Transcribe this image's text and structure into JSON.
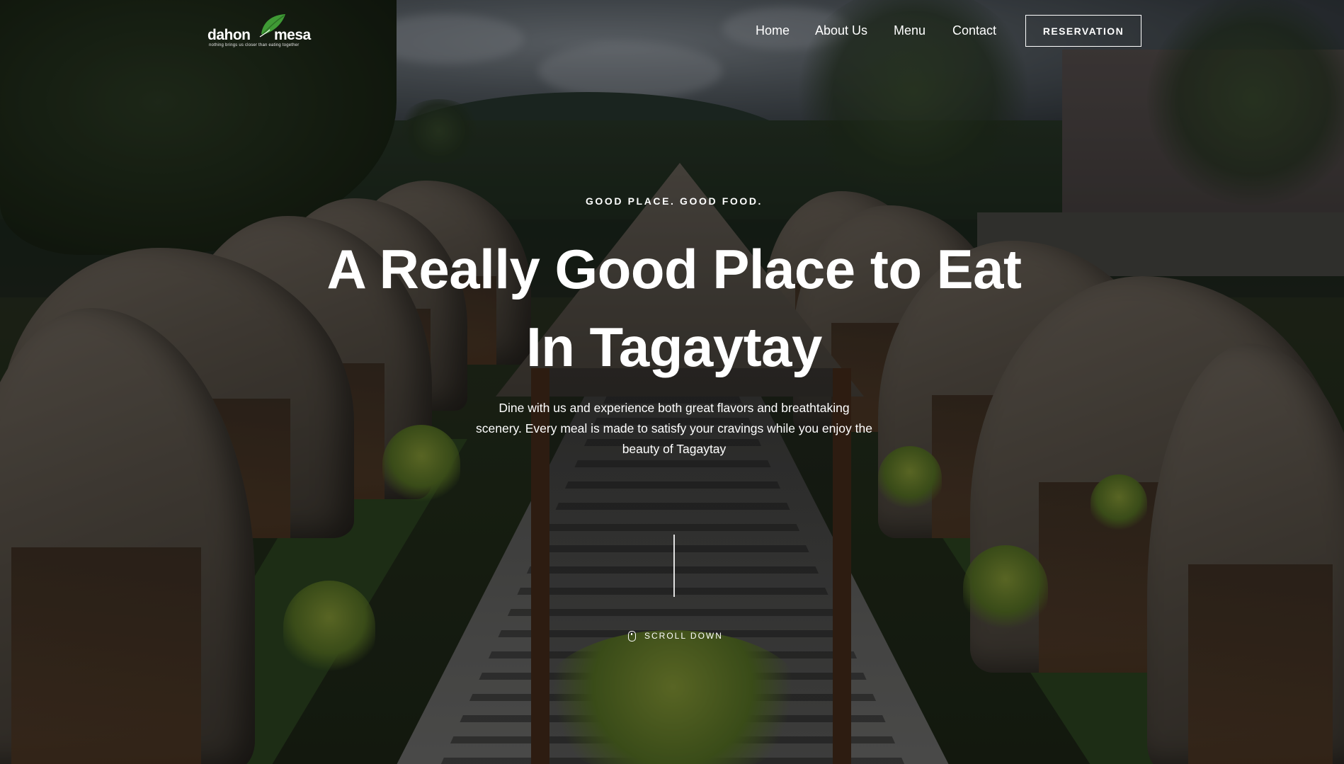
{
  "brand": {
    "name_left": "dahon",
    "name_right": "mesa",
    "tagline": "nothing brings us closer than eating together",
    "leaf_color": "#3f9a35"
  },
  "nav": {
    "items": [
      {
        "label": "Home"
      },
      {
        "label": "About Us"
      },
      {
        "label": "Menu"
      },
      {
        "label": "Contact"
      }
    ],
    "cta_label": "RESERVATION"
  },
  "hero": {
    "eyebrow": "GOOD PLACE. GOOD FOOD.",
    "title_line1": "A Really Good Place to Eat",
    "title_line2": "In Tagaytay",
    "description": "Dine with us and experience both great flavors and breathtaking scenery. Every meal is made to satisfy your cravings while you enjoy the beauty of Tagaytay",
    "scroll_label": "SCROLL DOWN",
    "scroll_icon": "mouse-icon"
  },
  "colors": {
    "text": "#ffffff",
    "overlay": "rgba(0,0,0,0.38)"
  }
}
